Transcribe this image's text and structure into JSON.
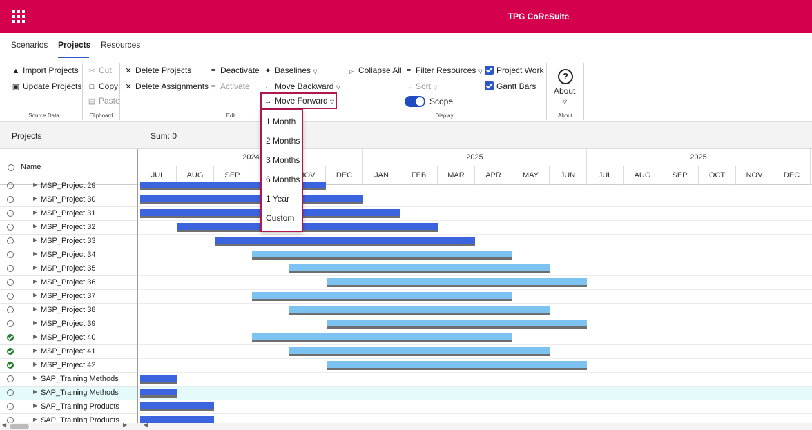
{
  "app": {
    "title": "TPG CoReSuite"
  },
  "tabs": [
    "Scenarios",
    "Projects",
    "Resources"
  ],
  "ribbon": {
    "source_data": {
      "caption": "Source Data",
      "import": "Import Projects",
      "update": "Update Projects"
    },
    "clipboard": {
      "caption": "Clipboard",
      "cut": "Cut",
      "copy": "Copy",
      "paste": "Paste"
    },
    "edit": {
      "caption": "Edit",
      "delete_projects": "Delete Projects",
      "delete_assignments": "Delete Assignments",
      "deactivate": "Deactivate",
      "activate": "Activate",
      "baselines": "Baselines",
      "move_backward": "Move Backward",
      "move_forward": "Move Forward"
    },
    "display": {
      "caption": "Display",
      "collapse_all": "Collapse All",
      "filter_resources": "Filter Resources",
      "sort": "Sort",
      "scope": "Scope",
      "project_work": "Project Work",
      "gantt_bars": "Gantt Bars"
    },
    "about": {
      "caption": "About",
      "label": "About"
    }
  },
  "move_forward_menu": [
    "1 Month",
    "2 Months",
    "3 Months",
    "6 Months",
    "1 Year",
    "Custom"
  ],
  "grid_header": {
    "title": "Projects",
    "sum": "Sum: 0",
    "name_col": "Name"
  },
  "timeline": {
    "years": [
      {
        "label": "2024"
      },
      {
        "label": "2025"
      },
      {
        "label": "2025"
      }
    ],
    "months": [
      "JUL",
      "AUG",
      "SEP",
      "OCT",
      "NOV",
      "DEC",
      "JAN",
      "FEB",
      "MAR",
      "APR",
      "MAY",
      "JUN",
      "JUL",
      "AUG",
      "SEP",
      "OCT",
      "NOV",
      "DEC"
    ]
  },
  "rows": [
    {
      "name": "MSP_Project 29",
      "status": "radio",
      "bar": {
        "start": 0,
        "end": 5,
        "color": "dark"
      }
    },
    {
      "name": "MSP_Project 30",
      "status": "radio",
      "bar": {
        "start": 0,
        "end": 6,
        "color": "dark"
      }
    },
    {
      "name": "MSP_Project 31",
      "status": "radio",
      "bar": {
        "start": 0,
        "end": 7,
        "color": "dark"
      }
    },
    {
      "name": "MSP_Project 32",
      "status": "radio",
      "bar": {
        "start": 1,
        "end": 8,
        "color": "dark"
      }
    },
    {
      "name": "MSP_Project 33",
      "status": "radio",
      "bar": {
        "start": 2,
        "end": 9,
        "color": "dark"
      }
    },
    {
      "name": "MSP_Project 34",
      "status": "radio",
      "bar": {
        "start": 3,
        "end": 10,
        "color": "light"
      }
    },
    {
      "name": "MSP_Project 35",
      "status": "radio",
      "bar": {
        "start": 4,
        "end": 11,
        "color": "light"
      }
    },
    {
      "name": "MSP_Project 36",
      "status": "radio",
      "bar": {
        "start": 5,
        "end": 12,
        "color": "light"
      }
    },
    {
      "name": "MSP_Project 37",
      "status": "radio",
      "bar": {
        "start": 3,
        "end": 10,
        "color": "light"
      }
    },
    {
      "name": "MSP_Project 38",
      "status": "radio",
      "bar": {
        "start": 4,
        "end": 11,
        "color": "light"
      }
    },
    {
      "name": "MSP_Project 39",
      "status": "radio",
      "bar": {
        "start": 5,
        "end": 12,
        "color": "light"
      }
    },
    {
      "name": "MSP_Project 40",
      "status": "ok",
      "bar": {
        "start": 3,
        "end": 10,
        "color": "light"
      }
    },
    {
      "name": "MSP_Project 41",
      "status": "ok",
      "bar": {
        "start": 4,
        "end": 11,
        "color": "light"
      }
    },
    {
      "name": "MSP_Project 42",
      "status": "ok",
      "bar": {
        "start": 5,
        "end": 12,
        "color": "light"
      }
    },
    {
      "name": "SAP_Training Methods",
      "status": "radio",
      "bar": {
        "start": 0,
        "end": 1,
        "color": "dark"
      }
    },
    {
      "name": "SAP_Training Methods",
      "status": "radio",
      "selected": true,
      "bar": {
        "start": 0,
        "end": 1,
        "color": "dark"
      }
    },
    {
      "name": "SAP_Training Products",
      "status": "radio",
      "bar": {
        "start": 0,
        "end": 2,
        "color": "dark"
      }
    },
    {
      "name": "SAP_Training Products",
      "status": "radio",
      "bar": {
        "start": 0,
        "end": 2,
        "color": "dark"
      }
    }
  ],
  "colors": {
    "brand": "#d4004d",
    "bar_dark": "#3b64de",
    "bar_light": "#7cc3f2",
    "baseline": "#6f6f6f",
    "accent": "#2b57c8",
    "highlight": "#b0164f"
  }
}
